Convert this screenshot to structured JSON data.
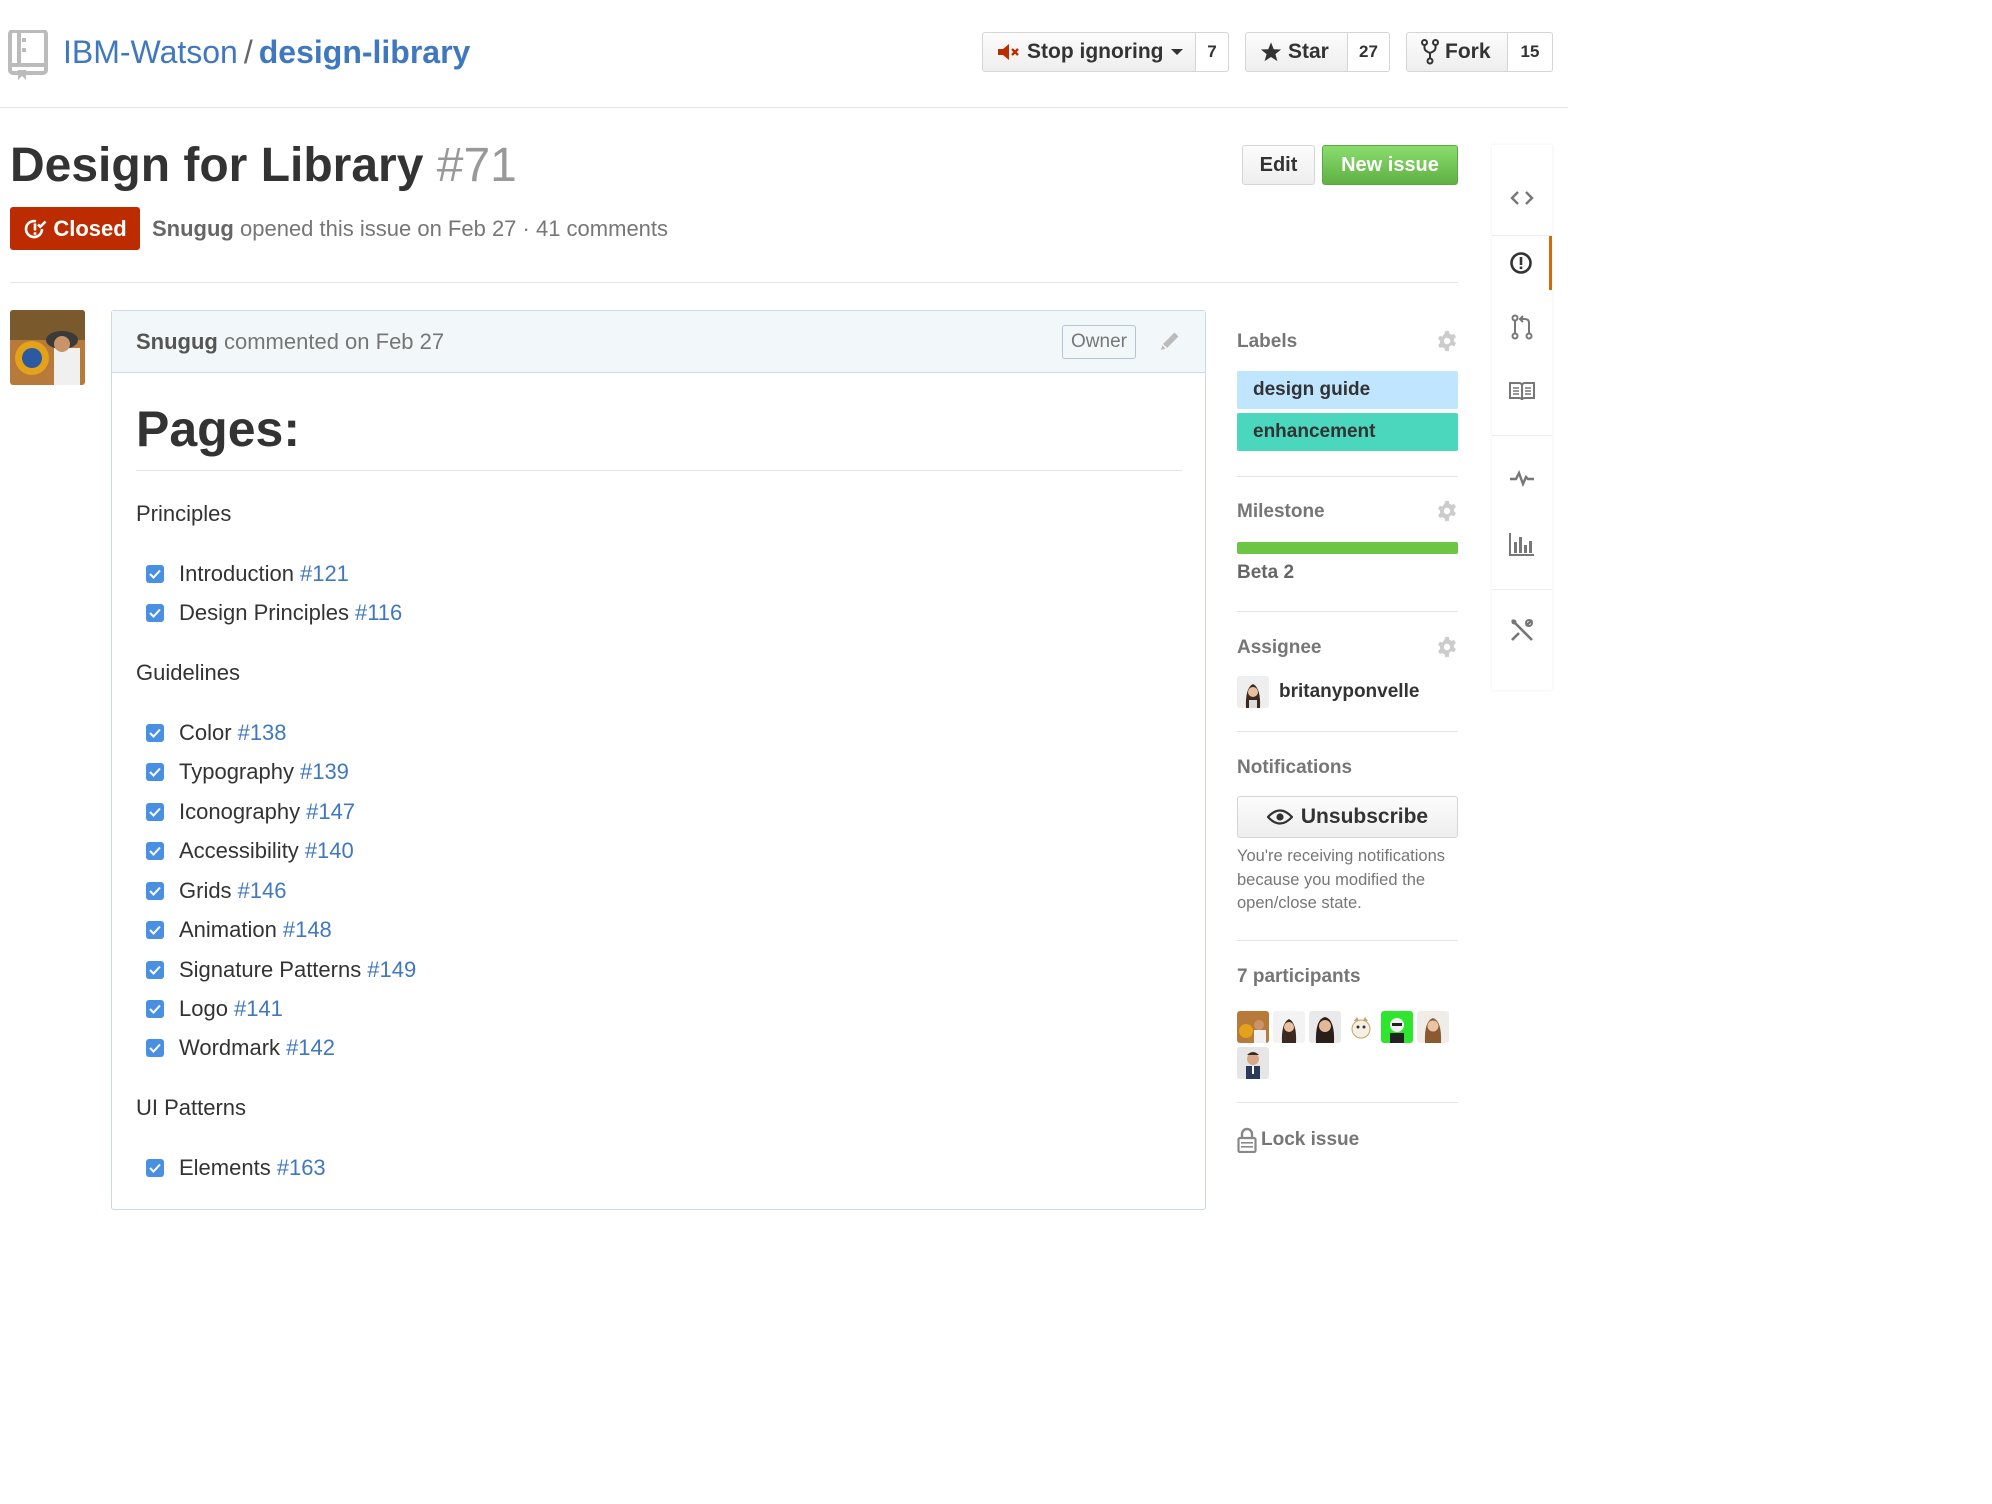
{
  "repo": {
    "owner": "IBM-Watson",
    "separator": "/",
    "name": "design-library"
  },
  "actions": {
    "watch": {
      "label": "Stop ignoring",
      "count": "7"
    },
    "star": {
      "label": "Star",
      "count": "27"
    },
    "fork": {
      "label": "Fork",
      "count": "15"
    }
  },
  "issue": {
    "title": "Design for Library",
    "number": "#71",
    "state": "Closed",
    "author": "Snugug",
    "meta_text": "opened this issue on Feb 27 · 41 comments",
    "edit_label": "Edit",
    "new_issue_label": "New issue"
  },
  "comment": {
    "author": "Snugug",
    "meta_text": "commented on Feb 27",
    "badge": "Owner",
    "heading": "Pages:",
    "sections": [
      {
        "title": "Principles",
        "tasks": [
          {
            "text": "Introduction",
            "ref": "#121"
          },
          {
            "text": "Design Principles",
            "ref": "#116"
          }
        ]
      },
      {
        "title": "Guidelines",
        "tasks": [
          {
            "text": "Color",
            "ref": "#138"
          },
          {
            "text": "Typography",
            "ref": "#139"
          },
          {
            "text": "Iconography",
            "ref": "#147"
          },
          {
            "text": "Accessibility",
            "ref": "#140"
          },
          {
            "text": "Grids",
            "ref": "#146"
          },
          {
            "text": "Animation",
            "ref": "#148"
          },
          {
            "text": "Signature Patterns",
            "ref": "#149"
          },
          {
            "text": "Logo",
            "ref": "#141"
          },
          {
            "text": "Wordmark",
            "ref": "#142"
          }
        ]
      },
      {
        "title": "UI Patterns",
        "tasks": [
          {
            "text": "Elements",
            "ref": "#163"
          }
        ]
      }
    ]
  },
  "sidebar": {
    "labels_heading": "Labels",
    "labels": [
      {
        "name": "design guide",
        "color": "#bfe5ff"
      },
      {
        "name": "enhancement",
        "color": "#4bd6be"
      }
    ],
    "milestone_heading": "Milestone",
    "milestone_progress": 1.0,
    "milestone_name": "Beta 2",
    "assignee_heading": "Assignee",
    "assignee": "britanyponvelle",
    "notifications_heading": "Notifications",
    "unsubscribe_label": "Unsubscribe",
    "notifications_text": "You're receiving notifications because you modified the open/close state.",
    "participants_heading": "7 participants",
    "lock_label": "Lock issue"
  },
  "colors": {
    "link": "#4078c0",
    "closed": "#bd2c00",
    "new_issue": "#6cc644",
    "nav_selected": "#d26911"
  },
  "nav_icons": [
    "code-icon",
    "issues-icon",
    "pull-request-icon",
    "wiki-icon",
    "pulse-icon",
    "graph-icon",
    "settings-icon"
  ]
}
